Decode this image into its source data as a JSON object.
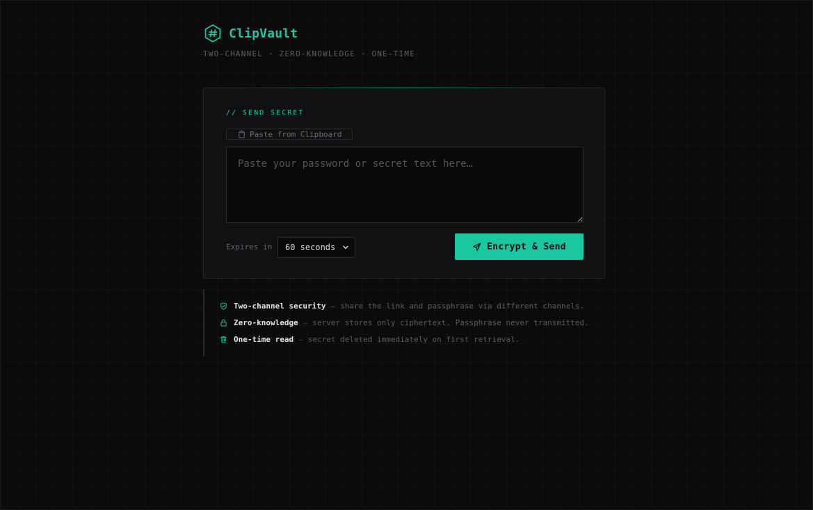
{
  "app": {
    "name": "ClipVault",
    "tagline": "TWO-CHANNEL · ZERO-KNOWLEDGE · ONE-TIME",
    "logo_icon": "hexagon-hash-icon",
    "accent_color": "#19c7a0"
  },
  "send_card": {
    "title": "// SEND SECRET",
    "paste_button_label": "Paste from Clipboard",
    "paste_button_icon": "clipboard-icon",
    "secret_input": {
      "placeholder": "Paste your password or secret text here…",
      "value": ""
    },
    "expires_label": "Expires in",
    "expires_selected": "60 seconds",
    "submit_label": "Encrypt & Send",
    "submit_icon": "send-icon"
  },
  "features": [
    {
      "icon": "shield-icon",
      "title": "Two-channel security",
      "separator": "—",
      "description": "share the link and passphrase via different channels."
    },
    {
      "icon": "lock-icon",
      "title": "Zero-knowledge",
      "separator": "—",
      "description": "server stores only ciphertext. Passphrase never transmitted."
    },
    {
      "icon": "trash-icon",
      "title": "One-time read",
      "separator": "—",
      "description": "secret deleted immediately on first retrieval."
    }
  ]
}
